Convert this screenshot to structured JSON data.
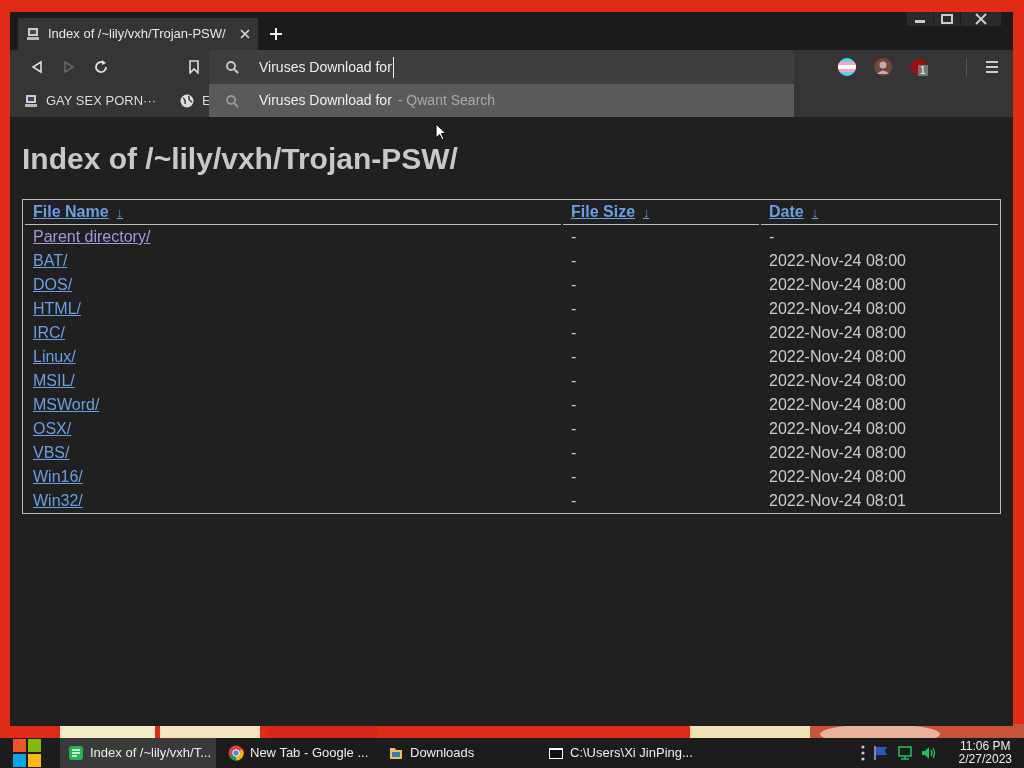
{
  "browser": {
    "tabs": [
      {
        "title": "Index of /~lily/vxh/Trojan-PSW/",
        "selected": true
      }
    ],
    "address_bar": {
      "value": "Viruses Download for"
    },
    "suggestions": [
      {
        "text": "Viruses Download for",
        "source": "- Qwant Search"
      }
    ],
    "extensions_badge": "1",
    "bookmarks": [
      {
        "label": "GAY SEX PORN···"
      },
      {
        "label": "E"
      }
    ]
  },
  "page": {
    "heading": "Index of /~lily/vxh/Trojan-PSW/",
    "columns": [
      {
        "label": "File Name",
        "sort": "↓"
      },
      {
        "label": "File Size",
        "sort": "↓"
      },
      {
        "label": "Date",
        "sort": "↓"
      }
    ],
    "rows": [
      {
        "name": "Parent directory/",
        "size": "-",
        "date": "-",
        "visited": true
      },
      {
        "name": "BAT/",
        "size": "-",
        "date": "2022-Nov-24 08:00",
        "visited": false
      },
      {
        "name": "DOS/",
        "size": "-",
        "date": "2022-Nov-24 08:00",
        "visited": false
      },
      {
        "name": "HTML/",
        "size": "-",
        "date": "2022-Nov-24 08:00",
        "visited": false
      },
      {
        "name": "IRC/",
        "size": "-",
        "date": "2022-Nov-24 08:00",
        "visited": false
      },
      {
        "name": "Linux/",
        "size": "-",
        "date": "2022-Nov-24 08:00",
        "visited": false
      },
      {
        "name": "MSIL/",
        "size": "-",
        "date": "2022-Nov-24 08:00",
        "visited": false
      },
      {
        "name": "MSWord/",
        "size": "-",
        "date": "2022-Nov-24 08:00",
        "visited": false
      },
      {
        "name": "OSX/",
        "size": "-",
        "date": "2022-Nov-24 08:00",
        "visited": false
      },
      {
        "name": "VBS/",
        "size": "-",
        "date": "2022-Nov-24 08:00",
        "visited": false
      },
      {
        "name": "Win16/",
        "size": "-",
        "date": "2022-Nov-24 08:00",
        "visited": false
      },
      {
        "name": "Win32/",
        "size": "-",
        "date": "2022-Nov-24 08:01",
        "visited": false
      }
    ]
  },
  "taskbar": {
    "items": [
      {
        "label": "Index of /~lily/vxh/T...",
        "kind": "notes",
        "selected": true
      },
      {
        "label": "New Tab - Google ...",
        "kind": "chrome",
        "selected": false
      },
      {
        "label": "Downloads",
        "kind": "folder",
        "selected": false
      },
      {
        "label": "C:\\Users\\Xi JinPing...",
        "kind": "console",
        "selected": false
      }
    ],
    "time": "11:06 PM",
    "date": "2/27/2023"
  }
}
